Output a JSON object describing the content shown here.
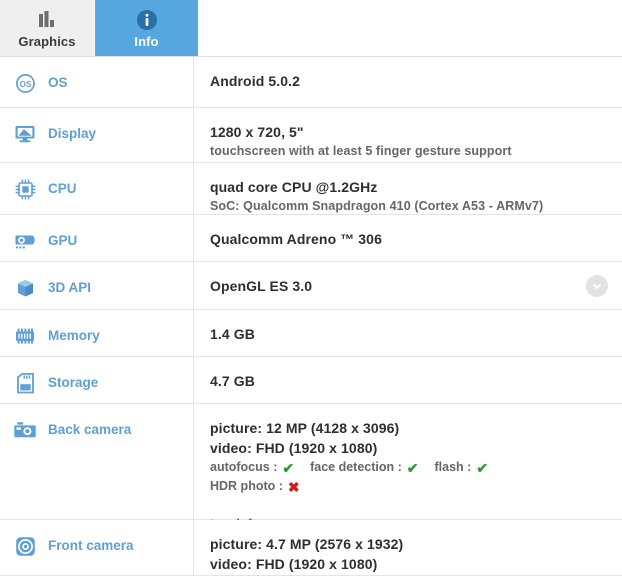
{
  "tabs": [
    {
      "id": "graphics",
      "label": "Graphics",
      "icon": "bar-chart-icon",
      "active": false
    },
    {
      "id": "info",
      "label": "Info",
      "icon": "info-icon",
      "active": true
    }
  ],
  "accent_color": "#56a7e0",
  "label_color": "#5f9fd4",
  "yes_color": "#2e9b2e",
  "no_color": "#cf2020",
  "rows": [
    {
      "id": "os",
      "icon": "os-circle-icon",
      "label": "OS",
      "value_main": "Android 5.0.2",
      "value_sub": ""
    },
    {
      "id": "display",
      "icon": "monitor-icon",
      "label": "Display",
      "value_main": "1280 x 720, 5\"",
      "value_sub": "touchscreen with at least 5 finger gesture support"
    },
    {
      "id": "cpu",
      "icon": "cpu-chip-icon",
      "label": "CPU",
      "value_main": "quad core CPU @1.2GHz",
      "value_sub": "SoC: Qualcomm Snapdragon 410 (Cortex A53 - ARMv7)"
    },
    {
      "id": "gpu",
      "icon": "gpu-card-icon",
      "label": "GPU",
      "value_main": "Qualcomm Adreno ™ 306",
      "value_sub": ""
    },
    {
      "id": "3d-api",
      "icon": "cube-icon",
      "label": "3D API",
      "value_main": "OpenGL ES 3.0",
      "value_sub": "",
      "expand_icon": "chevron-down-icon"
    },
    {
      "id": "memory",
      "icon": "ram-icon",
      "label": "Memory",
      "value_main": "1.4 GB",
      "value_sub": ""
    },
    {
      "id": "storage",
      "icon": "sd-card-icon",
      "label": "Storage",
      "value_main": "4.7 GB",
      "value_sub": ""
    },
    {
      "id": "back-camera",
      "icon": "camera-icon",
      "label": "Back camera",
      "value_main": "picture: 12 MP (4128 x 3096)",
      "value_sub": "video: FHD (1920 x 1080)",
      "features": [
        {
          "name": "autofocus :",
          "state": "yes",
          "mark": "✔"
        },
        {
          "name": "face detection :",
          "state": "yes",
          "mark": "✔"
        },
        {
          "name": "flash :",
          "state": "yes",
          "mark": "✔"
        },
        {
          "name": "HDR photo :",
          "state": "no",
          "mark": "✖"
        }
      ],
      "features2": [
        {
          "name": "touch focus :",
          "state": "yes",
          "mark": "✔"
        }
      ]
    },
    {
      "id": "front-camera",
      "icon": "front-camera-icon",
      "label": "Front camera",
      "value_main": "picture: 4.7 MP (2576 x 1932)",
      "value_sub": "video: FHD (1920 x 1080)"
    }
  ]
}
